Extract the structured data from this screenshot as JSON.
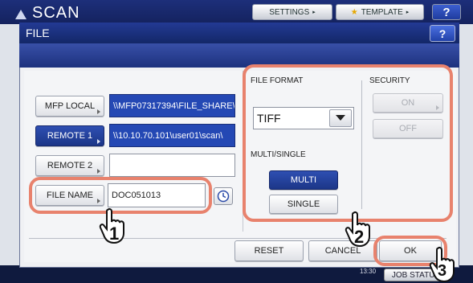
{
  "background": {
    "title": "SCAN",
    "settings_label": "SETTINGS",
    "template_label": "TEMPLATE",
    "help_label": "?",
    "job_status_label": "JOB STATUS",
    "time": "13:30"
  },
  "dialog": {
    "title": "FILE",
    "help_label": "?"
  },
  "destinations": {
    "mfp_local": {
      "label": "MFP LOCAL",
      "path": "\\\\MFP07317394\\FILE_SHARE\\"
    },
    "remote1": {
      "label": "REMOTE 1",
      "path": "\\\\10.10.70.101\\user01\\scan\\"
    },
    "remote2": {
      "label": "REMOTE 2",
      "path": ""
    }
  },
  "file_name": {
    "label": "FILE NAME",
    "value": "DOC051013"
  },
  "file_format": {
    "heading": "FILE FORMAT",
    "selected": "TIFF"
  },
  "security": {
    "heading": "SECURITY",
    "on_label": "ON",
    "off_label": "OFF"
  },
  "multi_single": {
    "heading": "MULTI/SINGLE",
    "multi_label": "MULTI",
    "single_label": "SINGLE"
  },
  "footer": {
    "reset_label": "RESET",
    "cancel_label": "CANCEL",
    "ok_label": "OK"
  },
  "callouts": [
    "1",
    "2",
    "3"
  ],
  "colors": {
    "highlight_ring": "#e8826d",
    "selected_blue": "#2448b4",
    "title_bar": "#1d327e"
  }
}
